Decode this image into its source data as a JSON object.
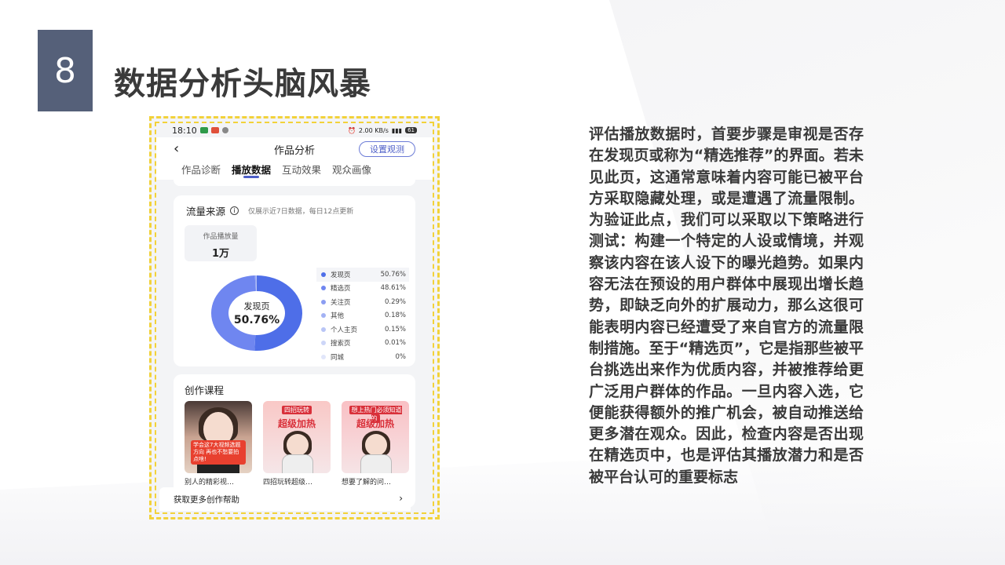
{
  "slide": {
    "number": "8",
    "title": "数据分析头脑风暴",
    "paragraph": "评估播放数据时，首要步骤是审视是否存在发现页或称为“精选推荐”的界面。若未见此页，这通常意味着内容可能已被平台方采取隐藏处理，或是遭遇了流量限制。为验证此点，我们可以采取以下策略进行测试：构建一个特定的人设或情境，并观察该内容在该人设下的曝光趋势。如果内容无法在预设的用户群体中展现出增长趋势，即缺乏向外的扩展动力，那么这很可能表明内容已经遭受了来自官方的流量限制措施。至于“精选页”，它是指那些被平台挑选出来作为优质内容，并被推荐给更广泛用户群体的作品。一旦内容入选，它便能获得额外的推广机会，被自动推送给更多潜在观众。因此，检查内容是否出现在精选页中，也是评估其播放潜力和是否被平台认可的重要标志"
  },
  "phone": {
    "status_time": "18:10",
    "status_right": "2.00 KB/s",
    "battery": "61",
    "nav_title": "作品分析",
    "set_button": "设置观测",
    "tabs": [
      "作品诊断",
      "播放数据",
      "互动效果",
      "观众画像"
    ],
    "active_tab": 1,
    "traffic": {
      "title": "流量来源",
      "note": "仅展示近7日数据，每日12点更新",
      "play_label": "作品播放量",
      "play_value": "1万",
      "center_label": "发现页",
      "center_value": "50.76%",
      "legend": [
        {
          "name": "发现页",
          "value": "50.76%",
          "color": "#4e6ee8"
        },
        {
          "name": "精选页",
          "value": "48.61%",
          "color": "#6f86f0"
        },
        {
          "name": "关注页",
          "value": "0.29%",
          "color": "#8b9df2"
        },
        {
          "name": "其他",
          "value": "0.18%",
          "color": "#a3b2f4"
        },
        {
          "name": "个人主页",
          "value": "0.15%",
          "color": "#b9c5f6"
        },
        {
          "name": "搜索页",
          "value": "0.01%",
          "color": "#cdd6f8"
        },
        {
          "name": "同城",
          "value": "0%",
          "color": "#e1e6fa"
        }
      ]
    },
    "courses": {
      "title": "创作课程",
      "items": [
        {
          "caption": "别人的精彩视…",
          "banner": "学会这7大视频选题方向 再也不愁要拍点啥!",
          "head": "",
          "big": ""
        },
        {
          "caption": "四招玩转超级…",
          "banner": "",
          "head": "四招玩转",
          "big": "超级加热"
        },
        {
          "caption": "想要了解的问…",
          "banner": "",
          "head": "想上热门必须知道的",
          "big": "超级加热"
        }
      ]
    },
    "help": "获取更多创作帮助"
  },
  "chart_data": {
    "type": "pie",
    "categories": [
      "发现页",
      "精选页",
      "关注页",
      "其他",
      "个人主页",
      "搜索页",
      "同城"
    ],
    "values": [
      50.76,
      48.61,
      0.29,
      0.18,
      0.15,
      0.01,
      0
    ]
  }
}
